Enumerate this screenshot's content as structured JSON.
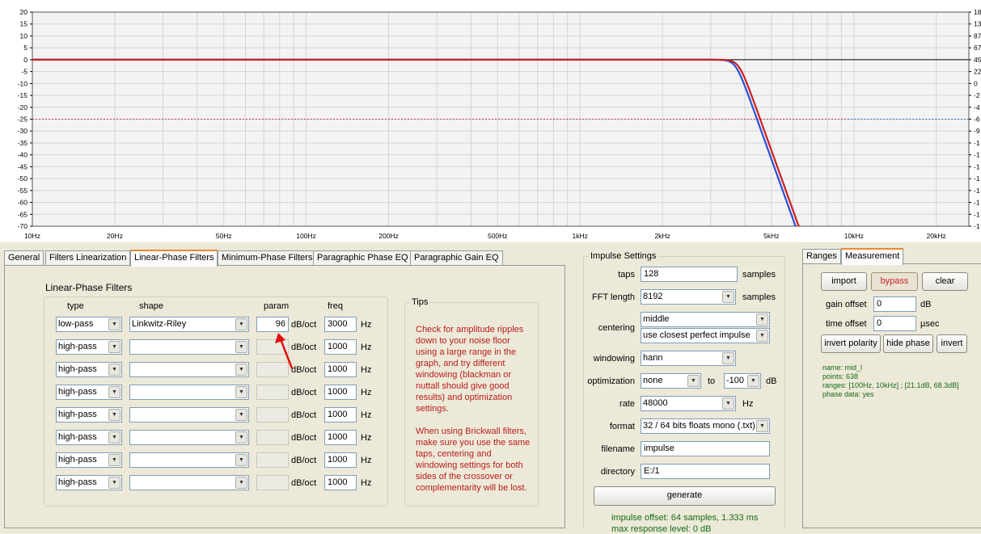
{
  "graph": {
    "y_ticks_left": [
      "20",
      "15",
      "10",
      "5",
      "0",
      "-5",
      "-10",
      "-15",
      "-20",
      "-25",
      "-30",
      "-35",
      "-40",
      "-45",
      "-50",
      "-55",
      "-60",
      "-65",
      "-70"
    ],
    "y_ticks_right": [
      "18",
      "13",
      "87",
      "67",
      "45",
      "22",
      "0",
      "-2",
      "-4",
      "-6",
      "-9",
      "-1",
      "-1",
      "-1",
      "-1",
      "-1",
      "-1",
      "-1",
      "-1"
    ],
    "x_ticks": [
      "10Hz",
      "20Hz",
      "50Hz",
      "100Hz",
      "200Hz",
      "500Hz",
      "1kHz",
      "2kHz",
      "5kHz",
      "10kHz",
      "20kHz"
    ],
    "colors": {
      "curve_red": "#cc1f1f",
      "curve_blue": "#2a4fd8",
      "reference_red": "#c04060",
      "reference_blue": "#3070c0",
      "grid": "#d4d4d4"
    }
  },
  "tabs": [
    {
      "label": "General"
    },
    {
      "label": "Filters Linearization"
    },
    {
      "label": "Linear-Phase Filters",
      "active": true
    },
    {
      "label": "Minimum-Phase Filters"
    },
    {
      "label": "Paragraphic Phase EQ"
    },
    {
      "label": "Paragraphic Gain EQ"
    }
  ],
  "linear_phase": {
    "title": "Linear-Phase Filters",
    "headers": {
      "type": "type",
      "shape": "shape",
      "param": "param",
      "freq": "freq"
    },
    "rows": [
      {
        "type": "low-pass",
        "shape": "Linkwitz-Riley",
        "param": "96",
        "unit": "dB/oct",
        "freq": "3000",
        "hz": "Hz"
      },
      {
        "type": "high-pass",
        "shape": "",
        "param": "",
        "unit": "dB/oct",
        "freq": "1000",
        "hz": "Hz"
      },
      {
        "type": "high-pass",
        "shape": "",
        "param": "",
        "unit": "dB/oct",
        "freq": "1000",
        "hz": "Hz"
      },
      {
        "type": "high-pass",
        "shape": "",
        "param": "",
        "unit": "dB/oct",
        "freq": "1000",
        "hz": "Hz"
      },
      {
        "type": "high-pass",
        "shape": "",
        "param": "",
        "unit": "dB/oct",
        "freq": "1000",
        "hz": "Hz"
      },
      {
        "type": "high-pass",
        "shape": "",
        "param": "",
        "unit": "dB/oct",
        "freq": "1000",
        "hz": "Hz"
      },
      {
        "type": "high-pass",
        "shape": "",
        "param": "",
        "unit": "dB/oct",
        "freq": "1000",
        "hz": "Hz"
      },
      {
        "type": "high-pass",
        "shape": "",
        "param": "",
        "unit": "dB/oct",
        "freq": "1000",
        "hz": "Hz"
      }
    ]
  },
  "tips": {
    "title": "Tips",
    "p1": "Check for amplitude ripples down to your noise floor using a large range in the graph, and try different windowing (blackman or nuttall should give good results) and optimization settings.",
    "p2": "When using Brickwall filters, make sure you use the same taps, centering and windowing settings for both sides of the crossover or complementarity will be lost."
  },
  "impulse": {
    "title": "Impulse Settings",
    "taps_label": "taps",
    "taps_value": "128",
    "taps_unit": "samples",
    "fft_label": "FFT length",
    "fft_value": "8192",
    "fft_unit": "samples",
    "centering_label": "centering",
    "centering_value": "middle",
    "centering_value2": "use closest perfect impulse",
    "windowing_label": "windowing",
    "windowing_value": "hann",
    "optimization_label": "optimization",
    "optimization_value": "none",
    "optimization_to": "to",
    "optimization_value2": "-100",
    "optimization_unit": "dB",
    "rate_label": "rate",
    "rate_value": "48000",
    "rate_unit": "Hz",
    "format_label": "format",
    "format_value": "32 / 64 bits floats mono (.txt)",
    "filename_label": "filename",
    "filename_value": "impulse",
    "directory_label": "directory",
    "directory_value": "E:/1",
    "generate_label": "generate",
    "status1": "impulse offset: 64 samples, 1.333 ms",
    "status2": "max response level: 0 dB"
  },
  "right_tabs": [
    {
      "label": "Ranges"
    },
    {
      "label": "Measurement",
      "active": true
    }
  ],
  "measurement": {
    "import_label": "import",
    "bypass_label": "bypass",
    "clear_label": "clear",
    "gain_offset_label": "gain offset",
    "gain_offset_value": "0",
    "gain_offset_unit": "dB",
    "time_offset_label": "time offset",
    "time_offset_value": "0",
    "time_offset_unit": "µsec",
    "invert_polarity_label": "invert polarity",
    "hide_phase_label": "hide phase",
    "invert_label": "invert",
    "info_name": "name: mid_l",
    "info_points": "points: 638",
    "info_ranges": "ranges: [100Hz, 10kHz] ; [21.1dB, 68.3dB]",
    "info_phase": "phase data: yes"
  }
}
